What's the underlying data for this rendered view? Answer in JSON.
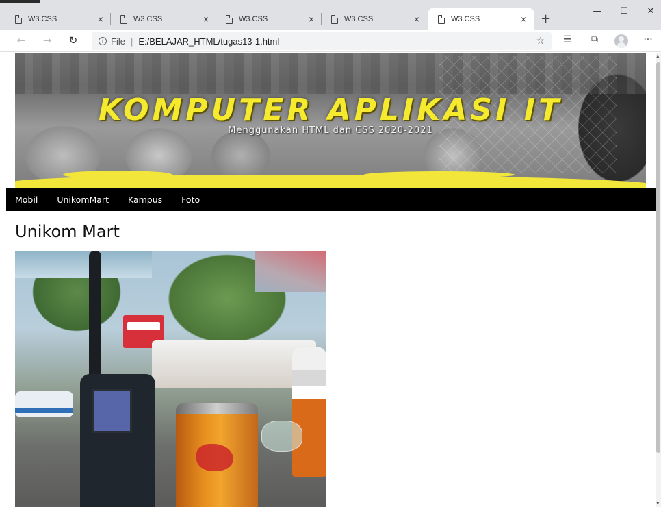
{
  "browser": {
    "tabs": [
      {
        "title": "W3.CSS",
        "active": false
      },
      {
        "title": "W3.CSS",
        "active": false
      },
      {
        "title": "W3.CSS",
        "active": false
      },
      {
        "title": "W3.CSS",
        "active": false
      },
      {
        "title": "W3.CSS",
        "active": true
      }
    ],
    "new_tab_label": "+",
    "tab_close_glyph": "×",
    "window_controls": {
      "minimize": "—",
      "maximize": "☐",
      "close": "✕"
    },
    "address": {
      "scheme_label": "File",
      "separator": "|",
      "url": "E:/BELAJAR_HTML/tugas13-1.html"
    },
    "icons": [
      "back-icon",
      "forward-icon",
      "reload-icon",
      "info-icon",
      "favorite-star-icon",
      "favorites-icon",
      "collections-icon",
      "profile-icon",
      "more-icon"
    ]
  },
  "page": {
    "banner": {
      "title": "KOMPUTER APLIKASI IT",
      "subtitle": "Menggunakan HTML dan CSS 2020-2021",
      "accent_color": "#f5ea2e"
    },
    "nav": {
      "items": [
        "Mobil",
        "UnikomMart",
        "Kampus",
        "Foto"
      ],
      "background": "#000000"
    },
    "section": {
      "heading": "Unikom Mart"
    }
  }
}
